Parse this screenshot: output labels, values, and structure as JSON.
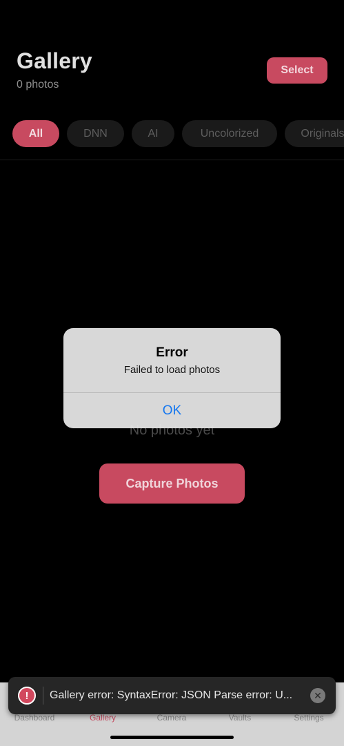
{
  "header": {
    "title": "Gallery",
    "subtitle": "0 photos",
    "select_label": "Select"
  },
  "filters": [
    {
      "label": "All",
      "active": true
    },
    {
      "label": "DNN",
      "active": false
    },
    {
      "label": "AI",
      "active": false
    },
    {
      "label": "Uncolorized",
      "active": false
    },
    {
      "label": "Originals",
      "active": false
    }
  ],
  "empty_state": {
    "message": "No photos yet",
    "button_label": "Capture Photos"
  },
  "alert": {
    "title": "Error",
    "message": "Failed to load photos",
    "ok_label": "OK"
  },
  "tabbar": {
    "items": [
      {
        "label": "Dashboard",
        "active": false
      },
      {
        "label": "Gallery",
        "active": true
      },
      {
        "label": "Camera",
        "active": false
      },
      {
        "label": "Vaults",
        "active": false
      },
      {
        "label": "Settings",
        "active": false
      }
    ]
  },
  "toast": {
    "icon": "error-icon",
    "message": "Gallery error: SyntaxError: JSON Parse error: U...",
    "close_icon": "close-icon"
  },
  "colors": {
    "accent": "#c84a60",
    "ok_blue": "#1477f0"
  }
}
